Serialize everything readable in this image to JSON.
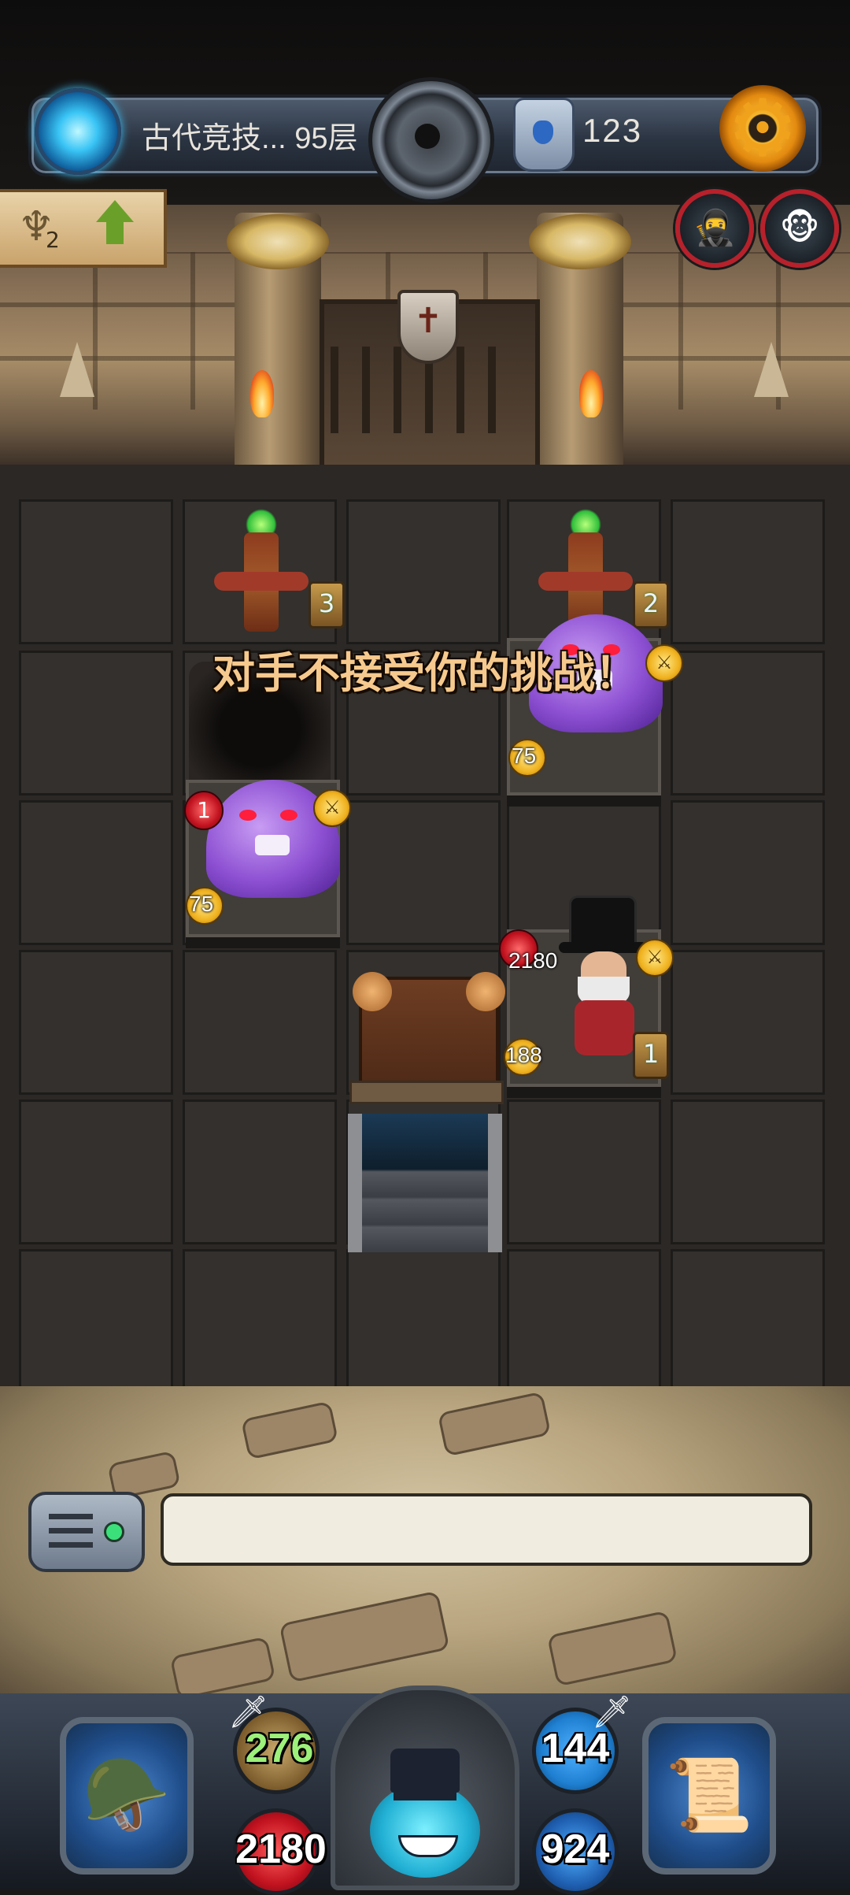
{
  "header": {
    "floor_label": "古代竞技... 95层",
    "currency_value": "123"
  },
  "level_badge": {
    "number": "2"
  },
  "board": {
    "toast": "对手不接受你的挑战！",
    "totems": [
      {
        "counter": "3"
      },
      {
        "counter": "2"
      }
    ],
    "ghost_left": {
      "hp": "1",
      "attack": "75"
    },
    "ghost_right": {
      "attack": "75"
    },
    "general": {
      "hp": "2180",
      "attack": "188",
      "counter": "1"
    }
  },
  "message": {
    "text": ""
  },
  "hud": {
    "attack": "276",
    "hp": "2180",
    "defense": "144",
    "mana": "924"
  },
  "colors": {
    "attack_text": "#9df07a",
    "hp_orb": "#c1121f",
    "defense_orb": "#1f7fd1",
    "accent_gold": "#f0b21f"
  }
}
